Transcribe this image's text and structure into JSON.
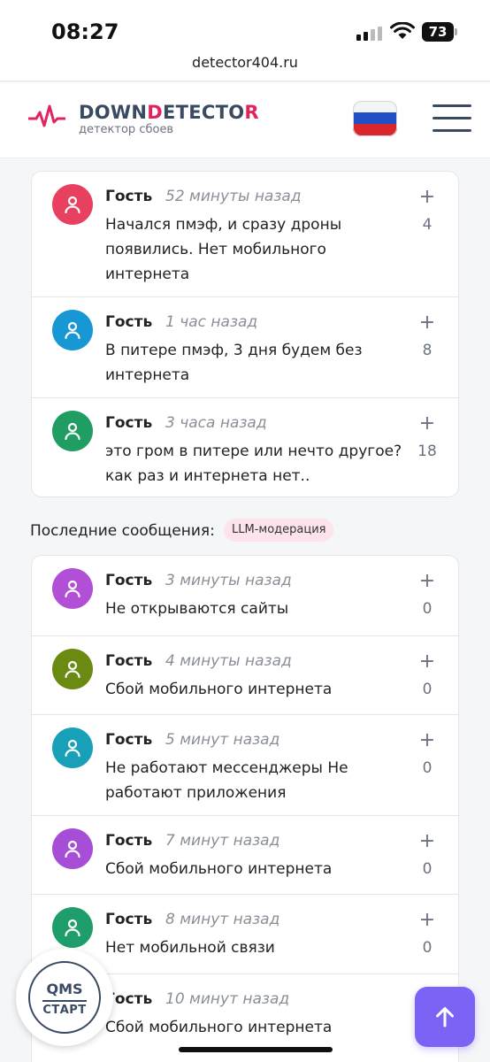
{
  "status_bar": {
    "time": "08:27",
    "battery": "73"
  },
  "browser": {
    "url": "detector404.ru"
  },
  "header": {
    "logo_parts": [
      "DOWN",
      "D",
      "ETECTO",
      "R"
    ],
    "subtitle": "детектор сбоев",
    "flag": "russia-flag"
  },
  "top_comments": [
    {
      "author": "Гость",
      "time": "52 минуты назад",
      "text": "Начался пмэф, и сразу дроны появились. Нет мобильного интернета",
      "votes": "4",
      "avatar_color": "#e8405f"
    },
    {
      "author": "Гость",
      "time": "1 час назад",
      "text": "В питере пмэф, 3 дня будем без интернета",
      "votes": "8",
      "avatar_color": "#1798d4"
    },
    {
      "author": "Гость",
      "time": "3 часа назад",
      "text": "это гром в питере или нечто другое? как раз и интернета нет..",
      "votes": "18",
      "avatar_color": "#1f9d63"
    }
  ],
  "latest": {
    "title": "Последние сообщения:",
    "badge": "LLM-модерация",
    "comments": [
      {
        "author": "Гость",
        "time": "3 минуты назад",
        "text": "Не открываются сайты",
        "votes": "0",
        "avatar_color": "#b14fd6"
      },
      {
        "author": "Гость",
        "time": "4 минуты назад",
        "text": "Сбой мобильного интернета",
        "votes": "0",
        "avatar_color": "#6a8a12"
      },
      {
        "author": "Гость",
        "time": "5 минут назад",
        "text": "Не работают мессенджеры Не работают приложения",
        "votes": "0",
        "avatar_color": "#17a0b8"
      },
      {
        "author": "Гость",
        "time": "7 минут назад",
        "text": "Сбой мобильного интернета",
        "votes": "0",
        "avatar_color": "#a64fd6"
      },
      {
        "author": "Гость",
        "time": "8 минут назад",
        "text": "Нет мобильной связи",
        "votes": "0",
        "avatar_color": "#1f9d6a"
      },
      {
        "author": "Гость",
        "time": "10 минут назад",
        "text": "Сбой мобильного интернета",
        "votes": "",
        "avatar_color": "#7a8a9a"
      }
    ]
  },
  "qms": {
    "top": "QMS",
    "bottom": "СТАРТ"
  },
  "icons": {
    "scroll_top": "arrow-up-icon",
    "avatar": "user-icon",
    "vote": "plus-icon",
    "menu": "hamburger-menu-icon"
  },
  "colors": {
    "accent": "#e0245e",
    "brand_dark": "#3b4a63",
    "fab": "#7c63f5",
    "badge_bg": "#fde4ec"
  }
}
